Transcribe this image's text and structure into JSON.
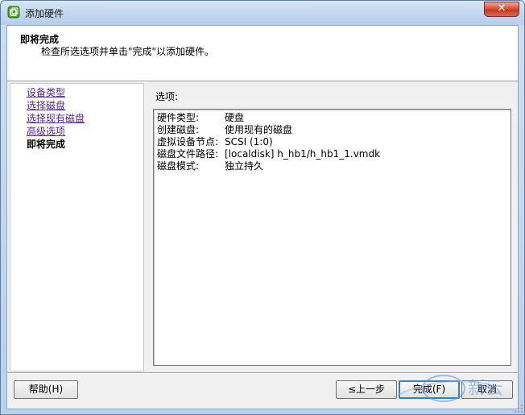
{
  "window": {
    "title": "添加硬件",
    "close_label": "✕"
  },
  "header": {
    "title": "即将完成",
    "subtitle": "检查所选选项并单击\"完成\"以添加硬件。"
  },
  "sidebar": {
    "steps": [
      {
        "label": "设备类型"
      },
      {
        "label": "选择磁盘"
      },
      {
        "label": "选择现有磁盘"
      },
      {
        "label": "高级选项"
      },
      {
        "label": "即将完成"
      }
    ]
  },
  "main": {
    "options_label": "选项:",
    "options": [
      {
        "key": "硬件类型:",
        "value": "硬盘"
      },
      {
        "key": "创建磁盘:",
        "value": "使用现有的磁盘"
      },
      {
        "key": "虚拟设备节点:",
        "value": "SCSI (1:0)"
      },
      {
        "key": "磁盘文件路径:",
        "value": "[localdisk] h_hb1/h_hb1_1.vmdk"
      },
      {
        "key": "磁盘模式:",
        "value": "独立持久"
      }
    ]
  },
  "footer": {
    "help_label": "帮助(H)",
    "back_label": "≤上一步",
    "finish_label": "完成(F)",
    "cancel_label": "取消"
  },
  "watermark": {
    "text": "新云"
  },
  "colors": {
    "link": "#5a2b8c",
    "close_red": "#c23a22",
    "default_button_border": "#3c7fb1"
  }
}
